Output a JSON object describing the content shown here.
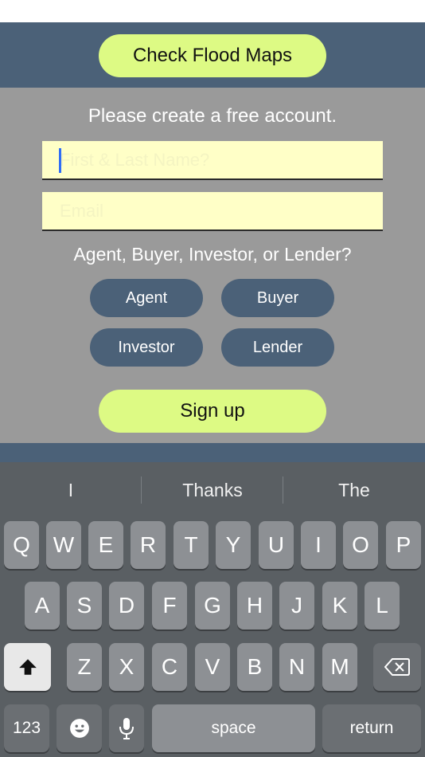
{
  "header": {
    "flood_button": "Check Flood Maps"
  },
  "form": {
    "prompt": "Please create a free account.",
    "name_placeholder": "First & Last Name?",
    "email_placeholder": "Email",
    "role_question": "Agent, Buyer, Investor, or Lender?",
    "roles": [
      "Agent",
      "Buyer",
      "Investor",
      "Lender"
    ],
    "signup_button": "Sign up"
  },
  "keyboard": {
    "suggestions": [
      "I",
      "Thanks",
      "The"
    ],
    "row1": [
      "Q",
      "W",
      "E",
      "R",
      "T",
      "Y",
      "U",
      "I",
      "O",
      "P"
    ],
    "row2": [
      "A",
      "S",
      "D",
      "F",
      "G",
      "H",
      "J",
      "K",
      "L"
    ],
    "row3": [
      "Z",
      "X",
      "C",
      "V",
      "B",
      "N",
      "M"
    ],
    "numbers_key": "123",
    "space_key": "space",
    "return_key": "return"
  },
  "colors": {
    "accent": "#ddfa84",
    "band": "#4b6178",
    "panel": "#9a9a9a",
    "field": "#ffffc7"
  }
}
